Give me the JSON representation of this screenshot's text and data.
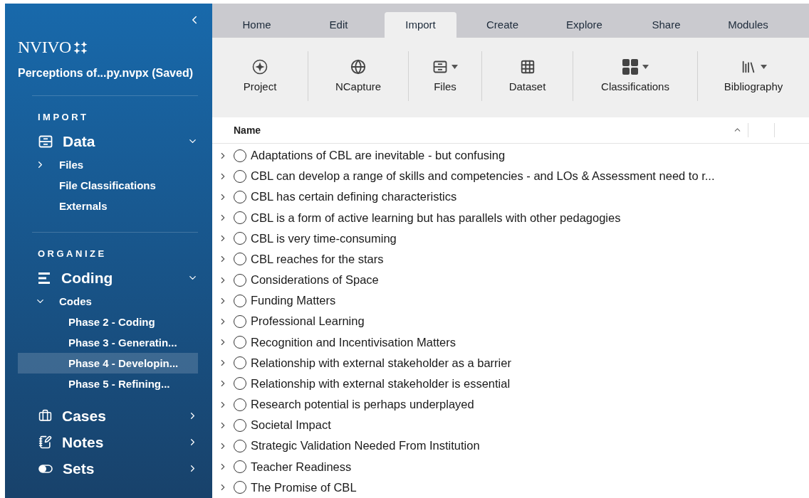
{
  "sidebar": {
    "logo": "NVIVO",
    "project_title": "Perceptions of...py.nvpx (Saved)",
    "sections": [
      {
        "heading": "IMPORT",
        "groups": [
          {
            "label": "Data",
            "expanded": true,
            "items": [
              {
                "label": "Files",
                "expanded": false,
                "selected": false
              },
              {
                "label": "File Classifications",
                "selected": false
              },
              {
                "label": "Externals",
                "selected": false
              }
            ]
          }
        ]
      },
      {
        "heading": "ORGANIZE",
        "groups": [
          {
            "label": "Coding",
            "expanded": true,
            "items": [
              {
                "label": "Codes",
                "expanded": true,
                "selected": false,
                "children": [
                  {
                    "label": "Phase 2 - Coding",
                    "selected": false
                  },
                  {
                    "label": "Phase 3 - Generatin...",
                    "selected": false
                  },
                  {
                    "label": "Phase 4 - Developin...",
                    "selected": true
                  },
                  {
                    "label": "Phase 5 - Refining...",
                    "selected": false
                  }
                ]
              }
            ]
          },
          {
            "label": "Cases",
            "expanded": false
          },
          {
            "label": "Notes",
            "expanded": false
          },
          {
            "label": "Sets",
            "expanded": false
          }
        ]
      }
    ]
  },
  "tabs": [
    {
      "label": "Home",
      "selected": false
    },
    {
      "label": "Edit",
      "selected": false
    },
    {
      "label": "Import",
      "selected": true
    },
    {
      "label": "Create",
      "selected": false
    },
    {
      "label": "Explore",
      "selected": false
    },
    {
      "label": "Share",
      "selected": false
    },
    {
      "label": "Modules",
      "selected": false
    }
  ],
  "ribbon": [
    {
      "label": "Project",
      "dropdown": false
    },
    {
      "label": "NCapture",
      "dropdown": false
    },
    {
      "label": "Files",
      "dropdown": true
    },
    {
      "label": "Dataset",
      "dropdown": false
    },
    {
      "label": "Classifications",
      "dropdown": true
    },
    {
      "label": "Bibliography",
      "dropdown": true
    }
  ],
  "table": {
    "columns": [
      {
        "label": "Name",
        "sort_ascending": true
      }
    ],
    "rows": [
      {
        "name": "Adaptations of CBL are inevitable - but confusing",
        "expanded": false
      },
      {
        "name": "CBL can develop a range of skills and competencies - and LOs & Assessment need to r...",
        "expanded": false
      },
      {
        "name": "CBL has certain defining characteristics",
        "expanded": false
      },
      {
        "name": "CBL is a form of active learning but has parallels with other pedagogies",
        "expanded": false
      },
      {
        "name": "CBL is very time-consuming",
        "expanded": false
      },
      {
        "name": "CBL reaches for the stars",
        "expanded": false
      },
      {
        "name": "Considerations of Space",
        "expanded": false
      },
      {
        "name": "Funding Matters",
        "expanded": false
      },
      {
        "name": "Professional Learning",
        "expanded": false
      },
      {
        "name": "Recognition and Incentivisation Matters",
        "expanded": false
      },
      {
        "name": "Relationship with external stakeholder as a barrier",
        "expanded": false
      },
      {
        "name": "Relationship with external stakeholder is essential",
        "expanded": false
      },
      {
        "name": "Research potential is perhaps underplayed",
        "expanded": false
      },
      {
        "name": "Societal Impact",
        "expanded": false
      },
      {
        "name": "Strategic Validation Needed From Institution",
        "expanded": false
      },
      {
        "name": "Teacher Readiness",
        "expanded": false
      },
      {
        "name": "The Promise of CBL",
        "expanded": false
      }
    ]
  }
}
